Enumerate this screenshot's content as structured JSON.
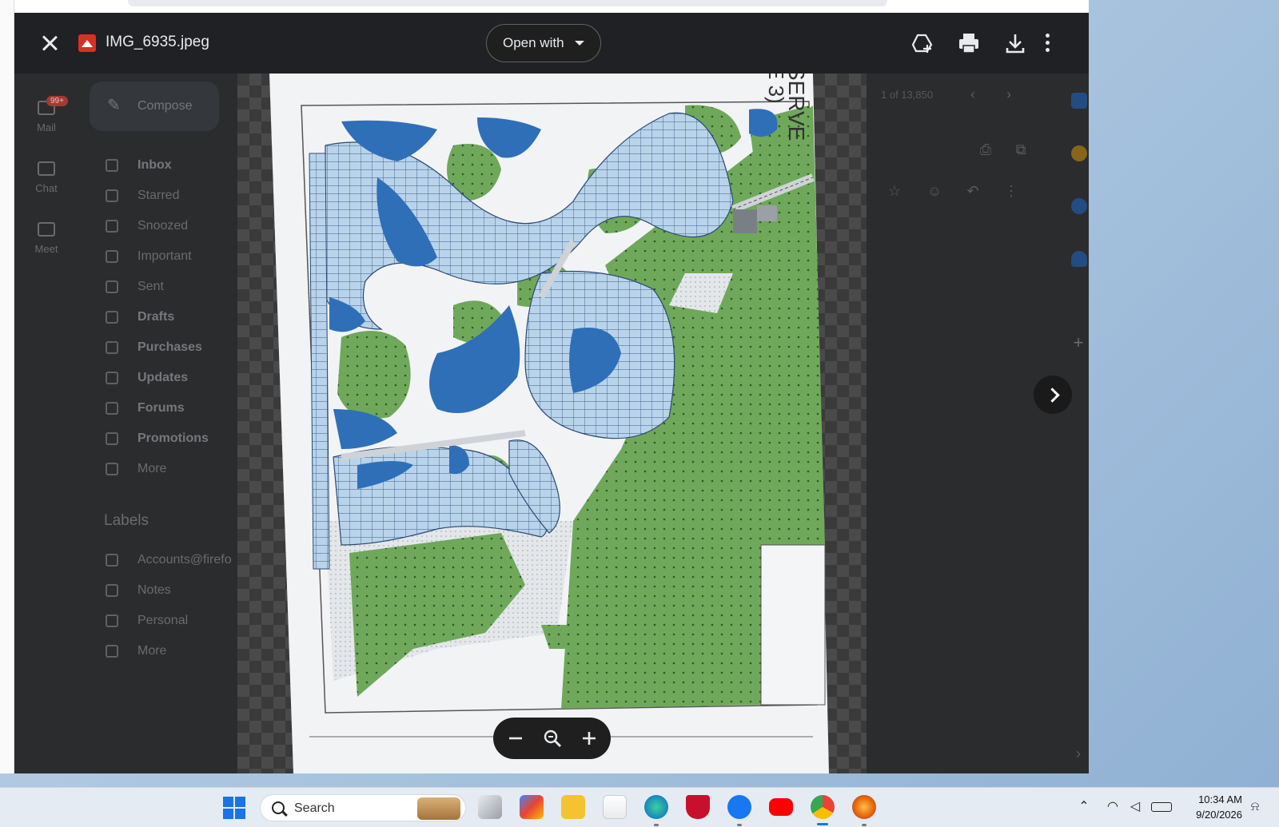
{
  "viewer": {
    "file_name": "IMG_6935.jpeg",
    "open_with_label": "Open with"
  },
  "gmail": {
    "rail": [
      {
        "label": "Mail",
        "badge": "99+"
      },
      {
        "label": "Chat"
      },
      {
        "label": "Meet"
      }
    ],
    "compose_label": "Compose",
    "nav": [
      {
        "label": "Inbox",
        "bold": true
      },
      {
        "label": "Starred",
        "bold": false
      },
      {
        "label": "Snoozed",
        "bold": false
      },
      {
        "label": "Important",
        "bold": false
      },
      {
        "label": "Sent",
        "bold": false
      },
      {
        "label": "Drafts",
        "bold": true
      },
      {
        "label": "Purchases",
        "bold": true
      },
      {
        "label": "Updates",
        "bold": true
      },
      {
        "label": "Forums",
        "bold": true
      },
      {
        "label": "Promotions",
        "bold": true
      },
      {
        "label": "More",
        "bold": false
      }
    ],
    "labels_heading": "Labels",
    "labels": [
      {
        "label": "Accounts@firefo"
      },
      {
        "label": "Notes"
      },
      {
        "label": "Personal"
      },
      {
        "label": "More"
      }
    ],
    "pagination": "1 of 13,850"
  },
  "taskbar": {
    "search_label": "Search",
    "time": "10:34 AM",
    "date": "9/20/2026"
  },
  "colors": {
    "viewer_bar": "#202124",
    "accent": "#1a73e8",
    "map_green": "#6fa85a",
    "map_water": "#2f6fb8"
  }
}
